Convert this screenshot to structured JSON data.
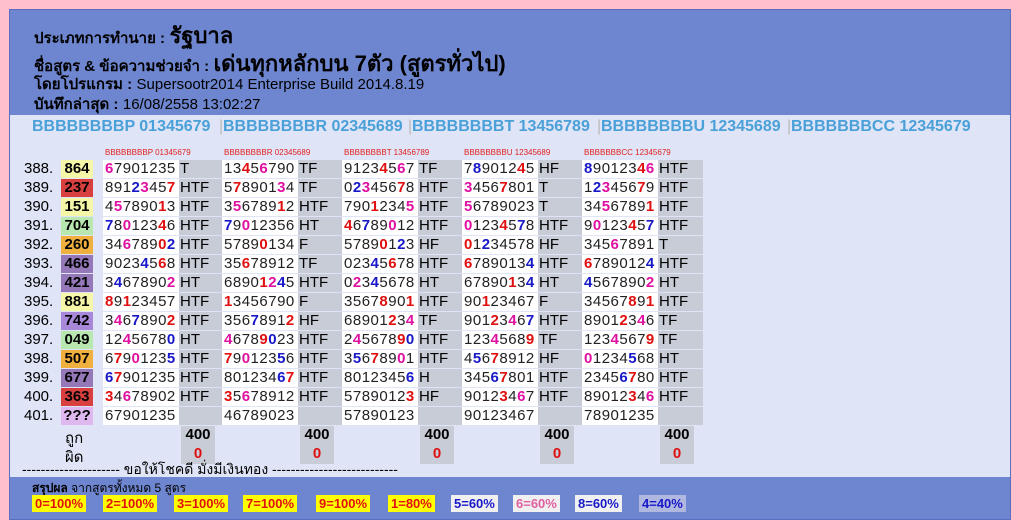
{
  "header": {
    "type_label": "ประเภทการทำนาย :",
    "type_value": "รัฐบาล",
    "formula_label": "ชื่อสูตร & ข้อความช่วยจำ :",
    "formula_value": "เด่นทุกหลักบน 7ตัว (สูตรทั่วไป)",
    "program_label": "โดยโปรแกรม :",
    "program_value": "Supersootr2014 Enterprise Build 2014.8.19",
    "saved_label": "บันทึกล่าสุด :",
    "saved_value": "16/08/2558 13:02:27"
  },
  "formulas": [
    "BBBBBBBBP 01345679",
    "BBBBBBBBR 02345689",
    "BBBBBBBBT 13456789",
    "BBBBBBBBU 12345689",
    "BBBBBBBCC 12345679"
  ],
  "column_headers": [
    "BBBBBBBBP 01345679",
    "BBBBBBBBR 02345689",
    "BBBBBBBBT 13456789",
    "BBBBBBBBU 12345689",
    "BBBBBBBCC 12345679"
  ],
  "draws": [
    {
      "num": "388.",
      "result": "864",
      "bg": "#f6f6a8"
    },
    {
      "num": "389.",
      "result": "237",
      "bg": "#d84040"
    },
    {
      "num": "390.",
      "result": "151",
      "bg": "#f6f6a8"
    },
    {
      "num": "391.",
      "result": "704",
      "bg": "#b8e8b0"
    },
    {
      "num": "392.",
      "result": "260",
      "bg": "#f0b040"
    },
    {
      "num": "393.",
      "result": "466",
      "bg": "#9478b8"
    },
    {
      "num": "394.",
      "result": "421",
      "bg": "#9478b8"
    },
    {
      "num": "395.",
      "result": "881",
      "bg": "#f6f6a8"
    },
    {
      "num": "396.",
      "result": "742",
      "bg": "#a888d8"
    },
    {
      "num": "397.",
      "result": "049",
      "bg": "#b8e8b0"
    },
    {
      "num": "398.",
      "result": "507",
      "bg": "#f0b040"
    },
    {
      "num": "399.",
      "result": "677",
      "bg": "#9478b8"
    },
    {
      "num": "400.",
      "result": "363",
      "bg": "#d84040"
    },
    {
      "num": "401.",
      "result": "???",
      "bg": "#e0b8f0"
    }
  ],
  "cells": [
    [
      [
        "67901235",
        "T"
      ],
      [
        "13456790",
        "TF"
      ],
      [
        "91234567",
        "TF"
      ],
      [
        "78901245",
        "HF"
      ],
      [
        "89012346",
        "HTF"
      ]
    ],
    [
      [
        "89123457",
        "HTF"
      ],
      [
        "57890134",
        "TF"
      ],
      [
        "02345678",
        "HTF"
      ],
      [
        "34567801",
        "T"
      ],
      [
        "12345679",
        "HTF"
      ]
    ],
    [
      [
        "45789013",
        "HTF"
      ],
      [
        "35678912",
        "HTF"
      ],
      [
        "79012345",
        "HTF"
      ],
      [
        "56789023",
        "T"
      ],
      [
        "34567891",
        "HTF"
      ]
    ],
    [
      [
        "78012346",
        "HTF"
      ],
      [
        "79012356",
        "HT"
      ],
      [
        "46789012",
        "HTF"
      ],
      [
        "01234578",
        "HTF"
      ],
      [
        "90123457",
        "HTF"
      ]
    ],
    [
      [
        "34678902",
        "HTF"
      ],
      [
        "57890134",
        "F"
      ],
      [
        "57890123",
        "HF"
      ],
      [
        "01234578",
        "HF"
      ],
      [
        "34567891",
        "T"
      ]
    ],
    [
      [
        "90234568",
        "HTF"
      ],
      [
        "35678912",
        "TF"
      ],
      [
        "02345678",
        "HTF"
      ],
      [
        "67890134",
        "HTF"
      ],
      [
        "67890124",
        "HTF"
      ]
    ],
    [
      [
        "34678902",
        "HT"
      ],
      [
        "68901245",
        "HTF"
      ],
      [
        "02345678",
        "HT"
      ],
      [
        "67890134",
        "HT"
      ],
      [
        "45678902",
        "HT"
      ]
    ],
    [
      [
        "89123457",
        "HTF"
      ],
      [
        "13456790",
        "F"
      ],
      [
        "35678901",
        "HTF"
      ],
      [
        "90123467",
        "F"
      ],
      [
        "34567891",
        "HTF"
      ]
    ],
    [
      [
        "34678902",
        "HTF"
      ],
      [
        "35678912",
        "HF"
      ],
      [
        "68901234",
        "TF"
      ],
      [
        "90123467",
        "HTF"
      ],
      [
        "89012346",
        "TF"
      ]
    ],
    [
      [
        "12456780",
        "HT"
      ],
      [
        "46789023",
        "HTF"
      ],
      [
        "24567890",
        "HTF"
      ],
      [
        "12345689",
        "TF"
      ],
      [
        "12345679",
        "TF"
      ]
    ],
    [
      [
        "67901235",
        "HTF"
      ],
      [
        "79012356",
        "HTF"
      ],
      [
        "35678901",
        "HTF"
      ],
      [
        "45678912",
        "HF"
      ],
      [
        "01234568",
        "HT"
      ]
    ],
    [
      [
        "67901235",
        "HTF"
      ],
      [
        "80123467",
        "HTF"
      ],
      [
        "80123456",
        "H"
      ],
      [
        "34567801",
        "HTF"
      ],
      [
        "23456780",
        "HTF"
      ]
    ],
    [
      [
        "34678902",
        "HTF"
      ],
      [
        "35678912",
        "HTF"
      ],
      [
        "57890123",
        "HF"
      ],
      [
        "90123467",
        "HTF"
      ],
      [
        "89012346",
        "HTF"
      ]
    ],
    [
      [
        "67901235",
        ""
      ],
      [
        "46789023",
        ""
      ],
      [
        "57890123",
        ""
      ],
      [
        "90123467",
        ""
      ],
      [
        "78901235",
        ""
      ]
    ]
  ],
  "totals": {
    "right_label": "ถูก",
    "wrong_label": "ผิด",
    "right": [
      "400",
      "400",
      "400",
      "400",
      "400"
    ],
    "wrong": [
      "0",
      "0",
      "0",
      "0",
      "0"
    ]
  },
  "footer_line": "--------------------- ขอให้โชคดี มั่งมีเงินทอง ---------------------------",
  "summary": {
    "title_bold": "สรุปผล",
    "title_rest": "จากสูตรทั้งหมด 5 สูตร",
    "chips": [
      {
        "label": "0=100%",
        "bg": "#ffff00",
        "fg": "#e01010"
      },
      {
        "label": "2=100%",
        "bg": "#ffff00",
        "fg": "#e01010"
      },
      {
        "label": "3=100%",
        "bg": "#ffff00",
        "fg": "#e01010"
      },
      {
        "label": "7=100%",
        "bg": "#ffff00",
        "fg": "#e01010"
      },
      {
        "label": "9=100%",
        "bg": "#ffff00",
        "fg": "#e01010"
      },
      {
        "label": "1=80%",
        "bg": "#ffff00",
        "fg": "#e01010"
      },
      {
        "label": "5=60%",
        "bg": "#f0f0f0",
        "fg": "#1818c8"
      },
      {
        "label": "6=60%",
        "bg": "#f0f0f0",
        "fg": "#e060a0"
      },
      {
        "label": "8=60%",
        "bg": "#f0f0f0",
        "fg": "#1818c8"
      },
      {
        "label": "4=40%",
        "bg": "#b0b8e0",
        "fg": "#1818c8"
      }
    ]
  }
}
